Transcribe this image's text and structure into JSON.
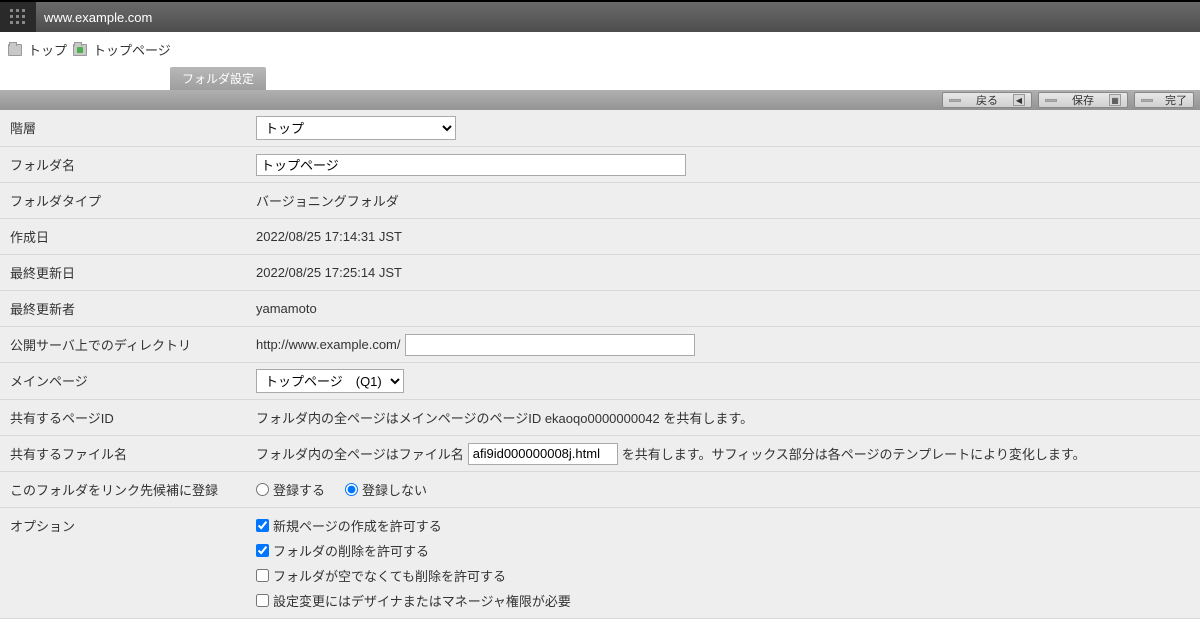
{
  "window": {
    "title": "www.example.com"
  },
  "breadcrumb": {
    "items": [
      {
        "label": "トップ"
      },
      {
        "label": "トップページ"
      }
    ]
  },
  "tabs": {
    "active": "フォルダ設定"
  },
  "toolbar": {
    "back": "戻る",
    "save": "保存",
    "done": "完了"
  },
  "form": {
    "hierarchy": {
      "label": "階層",
      "value": "トップ"
    },
    "folder_name": {
      "label": "フォルダ名",
      "value": "トップページ"
    },
    "folder_type": {
      "label": "フォルダタイプ",
      "value": "バージョニングフォルダ"
    },
    "created": {
      "label": "作成日",
      "value": "2022/08/25 17:14:31 JST"
    },
    "updated": {
      "label": "最終更新日",
      "value": "2022/08/25 17:25:14 JST"
    },
    "updater": {
      "label": "最終更新者",
      "value": "yamamoto"
    },
    "directory": {
      "label": "公開サーバ上でのディレクトリ",
      "prefix": "http://www.example.com/",
      "value": ""
    },
    "main_page": {
      "label": "メインページ",
      "value": "トップページ　(Q1)"
    },
    "shared_id": {
      "label": "共有するページID",
      "value": "フォルダ内の全ページはメインページのページID ekaoqo0000000042 を共有します。"
    },
    "shared_file": {
      "label": "共有するファイル名",
      "prefix": "フォルダ内の全ページはファイル名",
      "value": "afi9id000000008j.html",
      "suffix": "を共有します。サフィックス部分は各ページのテンプレートにより変化します。"
    },
    "register": {
      "label": "このフォルダをリンク先候補に登録",
      "opt_yes": "登録する",
      "opt_no": "登録しない"
    },
    "options": {
      "label": "オプション",
      "opt1": "新規ページの作成を許可する",
      "opt2": "フォルダの削除を許可する",
      "opt3": "フォルダが空でなくても削除を許可する",
      "opt4": "設定変更にはデザイナまたはマネージャ権限が必要"
    }
  }
}
